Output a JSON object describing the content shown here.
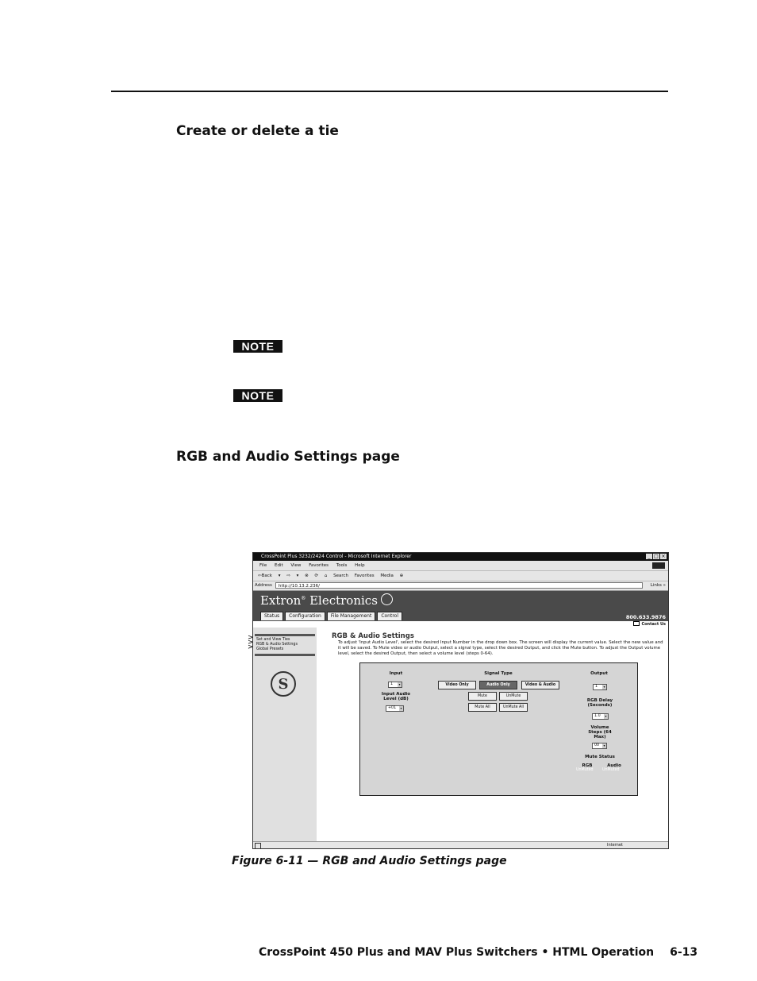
{
  "section1": {
    "heading": "Create or delete a tie"
  },
  "notes": [
    "NOTE",
    "NOTE"
  ],
  "section2": {
    "heading": "RGB and Audio Settings page"
  },
  "figure": {
    "caption": "Figure 6-11 — RGB and Audio Settings page",
    "window_title": "CrossPoint Plus 3232/2424 Control - Microsoft Internet Explorer",
    "menu": [
      "File",
      "Edit",
      "View",
      "Favorites",
      "Tools",
      "Help"
    ],
    "toolbar": [
      "⇦Back",
      "▾",
      "⇨",
      "▾",
      "⊗",
      "⟳",
      "⌂",
      "Search",
      "Favorites",
      "Media",
      "⊕"
    ],
    "address_label": "Address",
    "address_value": "http://10.13.2.236/",
    "links_label": "Links »",
    "brand": "Extron",
    "brand_reg": "®",
    "brand2": " Electronics",
    "tabs": [
      "Status",
      "Configuration",
      "File Management",
      "Control"
    ],
    "phone": "800.633.9876",
    "contact": "Contact Us",
    "sidebar_items": [
      "Set and View Ties",
      "RGB & Audio Settings",
      "Global Presets"
    ],
    "page_title": "RGB & Audio Settings",
    "description": "To adjust 'Input Audio Level', select the desired Input Number in the drop down box. The screen will display the current value. Select the new value and it will be saved. To Mute video or audio Output, select a signal type, select the desired Output, and click the Mute button. To adjust the Output volume level, select the desired Output, then select a volume level (steps 0-64).",
    "panel": {
      "input_label": "Input",
      "input_value": "1",
      "input_audio_label": "Input Audio Level (dB)",
      "input_audio_value": "+01",
      "signal_type_label": "Signal Type",
      "btn_video_only": "Video Only",
      "btn_audio_only": "Audio Only",
      "btn_video_audio": "Video & Audio",
      "btn_mute": "Mute",
      "btn_unmute": "UnMute",
      "btn_mute_all": "Mute All",
      "btn_unmute_all": "UnMute All",
      "output_label": "Output",
      "output_value": "1",
      "rgb_delay_label": "RGB Delay (Seconds)",
      "rgb_delay_value": "1.0",
      "volume_label": "Volume Steps (64 Max)",
      "volume_value": "00",
      "mute_status_label": "Mute Status",
      "rgb_label": "RGB",
      "audio_label": "Audio",
      "rgb_status": "UnMuted",
      "audio_status": "UnMuted"
    },
    "status_zone": "Internet"
  },
  "footer": {
    "title": "CrossPoint 450 Plus and MAV Plus Switchers • HTML Operation",
    "page": "6-13"
  }
}
